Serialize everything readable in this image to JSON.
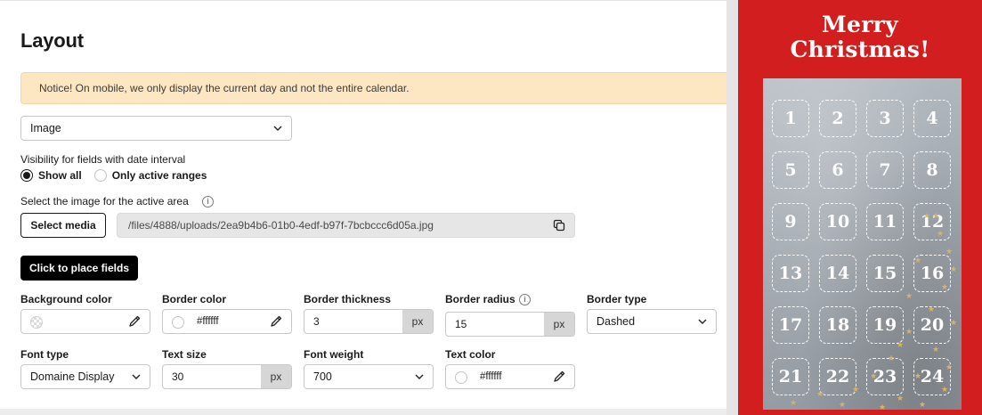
{
  "page": {
    "title": "Layout"
  },
  "notice": {
    "text": "Notice! On mobile, we only display the current day and not the entire calendar."
  },
  "layout_select": {
    "value": "Image"
  },
  "visibility": {
    "label": "Visibility for fields with date interval",
    "options": [
      {
        "label": "Show all",
        "selected": true
      },
      {
        "label": "Only active ranges",
        "selected": false
      }
    ]
  },
  "image_select": {
    "label": "Select the image for the active area",
    "button_label": "Select media",
    "path": "/files/4888/uploads/2ea9b4b6-01b0-4edf-b97f-7bcbccc6d05a.jpg"
  },
  "place_fields_button": "Click to place fields",
  "background_color": {
    "label": "Background color",
    "value": ""
  },
  "border_color": {
    "label": "Border color",
    "value": "#ffffff"
  },
  "border_thickness": {
    "label": "Border thickness",
    "value": "3",
    "unit": "px"
  },
  "border_radius": {
    "label": "Border radius",
    "value": "15",
    "unit": "px"
  },
  "border_type": {
    "label": "Border type",
    "value": "Dashed"
  },
  "font_type": {
    "label": "Font type",
    "value": "Domaine Display"
  },
  "text_size": {
    "label": "Text size",
    "value": "30",
    "unit": "px"
  },
  "font_weight": {
    "label": "Font weight",
    "value": "700"
  },
  "text_color": {
    "label": "Text color",
    "value": "#ffffff"
  },
  "preview": {
    "heading_line1": "Merry",
    "heading_line2": "Christmas!",
    "background": "#d21e1e",
    "days": [
      "1",
      "2",
      "3",
      "4",
      "5",
      "6",
      "7",
      "8",
      "9",
      "10",
      "11",
      "12",
      "13",
      "14",
      "15",
      "16",
      "17",
      "18",
      "19",
      "20",
      "21",
      "22",
      "23",
      "24"
    ]
  },
  "icons": [
    "chevron-down-icon",
    "info-icon",
    "copy-icon",
    "eyedropper-icon"
  ]
}
